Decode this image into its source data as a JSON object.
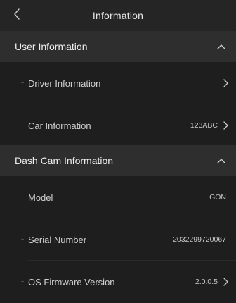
{
  "header": {
    "title": "Information"
  },
  "sections": [
    {
      "title": "User Information",
      "rows": [
        {
          "label": "Driver Information",
          "value": ""
        },
        {
          "label": "Car Information",
          "value": "123ABC"
        }
      ]
    },
    {
      "title": "Dash Cam Information",
      "rows": [
        {
          "label": "Model",
          "value": "GON"
        },
        {
          "label": "Serial Number",
          "value": "2032299720067"
        },
        {
          "label": "OS Firmware Version",
          "value": "2.0.0.5"
        }
      ]
    }
  ],
  "icons": {
    "back": "chevron-left-icon",
    "collapse": "chevron-up-icon",
    "navigate": "chevron-right-icon"
  },
  "colors": {
    "background": "#1e1e1e",
    "header": "#252525",
    "section": "#2e2e2e",
    "text": "#e8e8e8"
  }
}
